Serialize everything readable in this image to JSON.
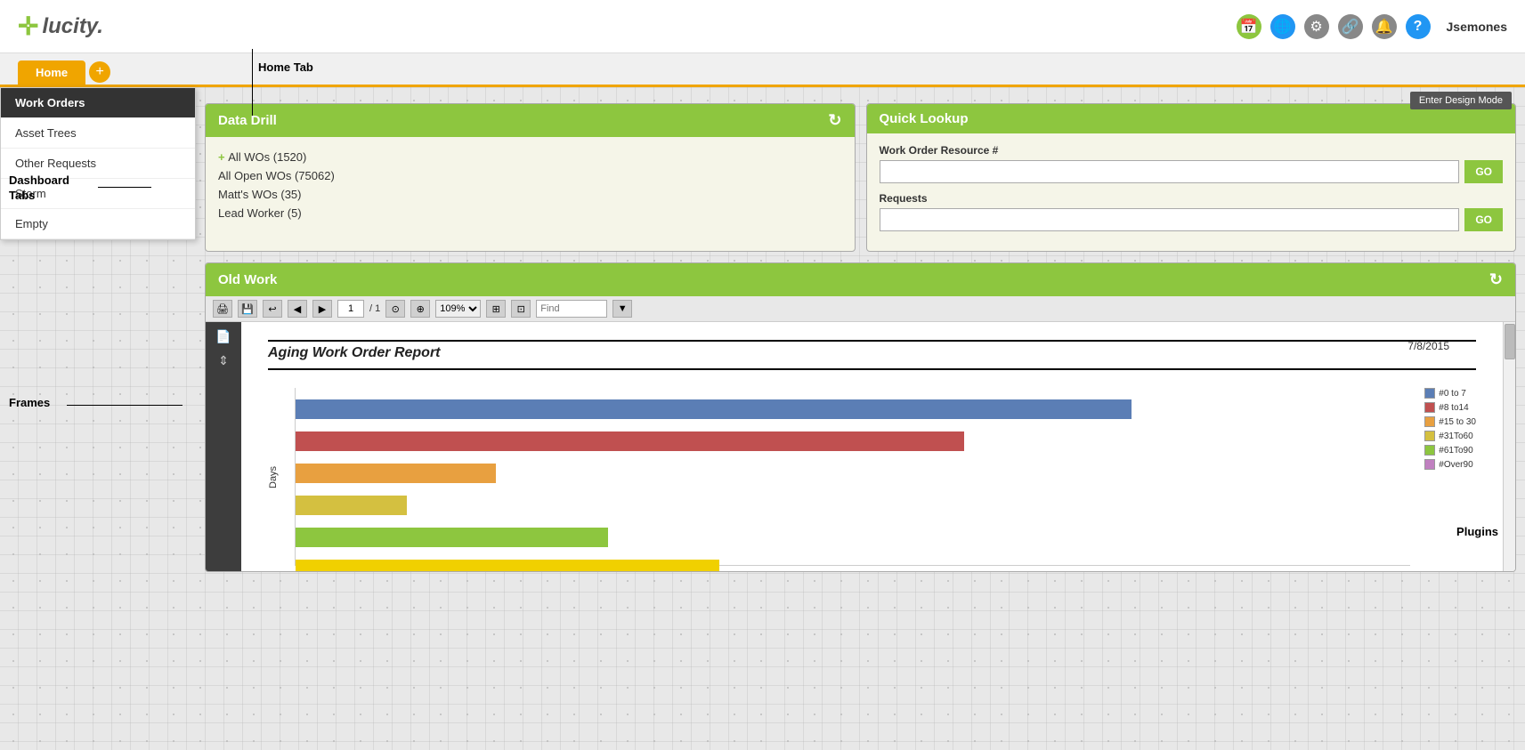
{
  "header": {
    "logo_plus": "✛",
    "logo_text": "lucity.",
    "icons": [
      {
        "name": "calendar-icon",
        "symbol": "📅",
        "class": "green"
      },
      {
        "name": "globe-icon",
        "symbol": "🌐",
        "class": "blue"
      },
      {
        "name": "settings-icon",
        "symbol": "⚙",
        "class": "gray"
      },
      {
        "name": "link-icon",
        "symbol": "🔗",
        "class": "gray"
      },
      {
        "name": "bell-icon",
        "symbol": "🔔",
        "class": "gray"
      },
      {
        "name": "help-icon",
        "symbol": "?",
        "class": "blue"
      }
    ],
    "username": "Jsemones"
  },
  "tabs": {
    "home_label": "Home",
    "add_label": "+"
  },
  "sidebar": {
    "items": [
      {
        "label": "Work Orders",
        "active": true
      },
      {
        "label": "Asset Trees",
        "active": false
      },
      {
        "label": "Other Requests",
        "active": false
      },
      {
        "label": "Storm",
        "active": false
      },
      {
        "label": "Empty",
        "active": false
      }
    ]
  },
  "design_mode_btn": "Enter Design Mode",
  "frames": {
    "data_drill": {
      "title": "Data Drill",
      "items": [
        {
          "text": "All WOs (1520)",
          "has_plus": true
        },
        {
          "text": "All Open WOs (75062)",
          "has_plus": false
        },
        {
          "text": "Matt's WOs (35)",
          "has_plus": false
        },
        {
          "text": "Lead Worker (5)",
          "has_plus": false
        }
      ]
    },
    "quick_lookup": {
      "title": "Quick Lookup",
      "fields": [
        {
          "label": "Work Order Resource #",
          "go_label": "GO"
        },
        {
          "label": "Requests",
          "go_label": "GO"
        }
      ]
    },
    "old_work": {
      "title": "Old Work",
      "toolbar": {
        "page_current": "1",
        "page_total": "/ 1",
        "zoom": "109%",
        "find_placeholder": "Find"
      },
      "report": {
        "title": "Aging Work Order Report",
        "date": "7/8/2015"
      },
      "chart": {
        "y_label": "Days",
        "bars": [
          {
            "color": "#5b7eb5",
            "width_pct": 75
          },
          {
            "color": "#c05050",
            "width_pct": 60
          },
          {
            "color": "#e8a040",
            "width_pct": 18
          },
          {
            "color": "#d4c040",
            "width_pct": 10
          },
          {
            "color": "#8dc63f",
            "width_pct": 28
          },
          {
            "color": "#f0d000",
            "width_pct": 38
          }
        ],
        "legend": [
          {
            "label": "#0 to 7",
            "color": "#5b7eb5"
          },
          {
            "label": "#8 to14",
            "color": "#c05050"
          },
          {
            "label": "#15 to 30",
            "color": "#e8a040"
          },
          {
            "label": "#31To60",
            "color": "#d4c040"
          },
          {
            "label": "#61To90",
            "color": "#8dc63f"
          },
          {
            "label": "#Over90",
            "color": "#c080c0"
          }
        ]
      }
    }
  },
  "annotations": {
    "home_tab": "Home Tab",
    "dashboard_tabs": "Dashboard\nTabs",
    "frames": "Frames",
    "plugins": "Plugins"
  }
}
